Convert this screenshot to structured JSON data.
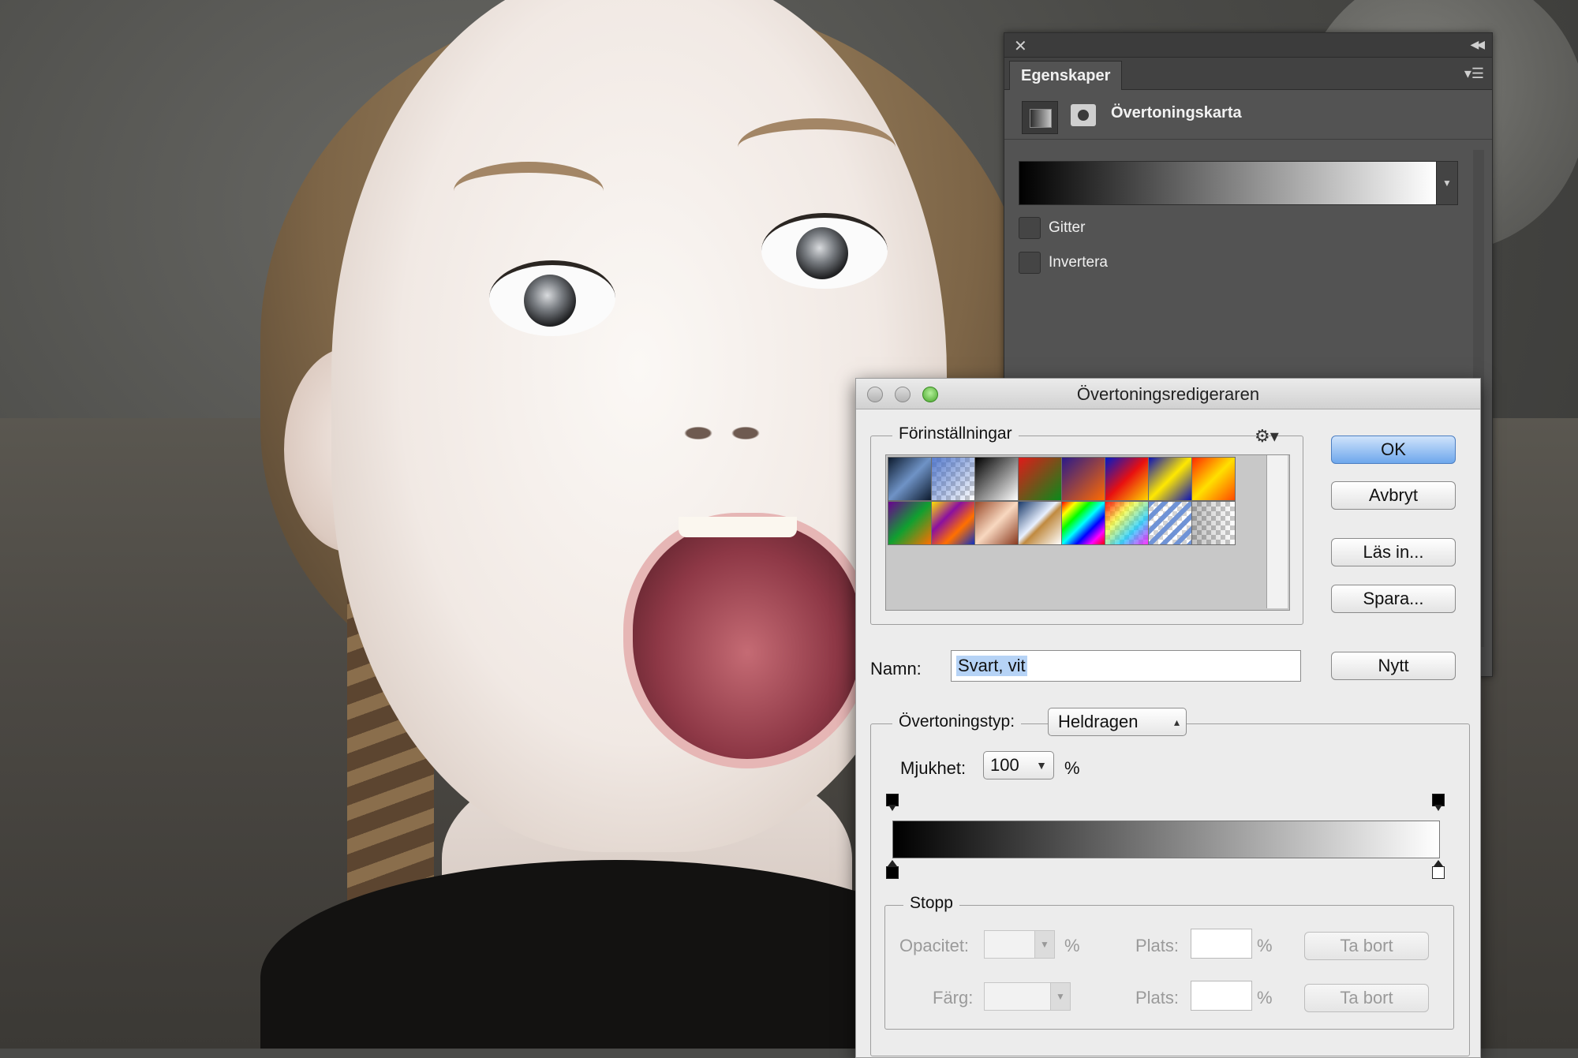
{
  "properties_panel": {
    "tab": "Egenskaper",
    "adjustment_title": "Övertoningskarta",
    "checkboxes": [
      {
        "label": "Gitter",
        "checked": false
      },
      {
        "label": "Invertera",
        "checked": false
      }
    ]
  },
  "dialog": {
    "title": "Övertoningsredigeraren",
    "presets_label": "Förinställningar",
    "preset_swatches": [
      "steel",
      "transparent-blue",
      "black-white",
      "red-green",
      "violet-orange",
      "blue-red-yellow",
      "blue-yellow-blue",
      "orange-yellow-orange",
      "violet-green-orange",
      "yellow-violet-orange-blue",
      "copper",
      "chrome",
      "spectrum",
      "transparent-rainbow",
      "transparent-stripes",
      "neutral-density"
    ],
    "buttons": {
      "ok": "OK",
      "cancel": "Avbryt",
      "load": "Läs in...",
      "save": "Spara...",
      "new": "Nytt"
    },
    "name_label": "Namn:",
    "name_value": "Svart, vit",
    "gradient_type_label": "Övertoningstyp:",
    "gradient_type_value": "Heldragen",
    "smoothness_label": "Mjukhet:",
    "smoothness_value": "100",
    "percent": "%",
    "stops_label": "Stopp",
    "opacity_label": "Opacitet:",
    "color_label": "Färg:",
    "location_label": "Plats:",
    "delete_label": "Ta bort"
  },
  "colors": {
    "ok_button": "#6ea7ec",
    "panel_bg": "#535353",
    "dialog_bg": "#ececec"
  }
}
